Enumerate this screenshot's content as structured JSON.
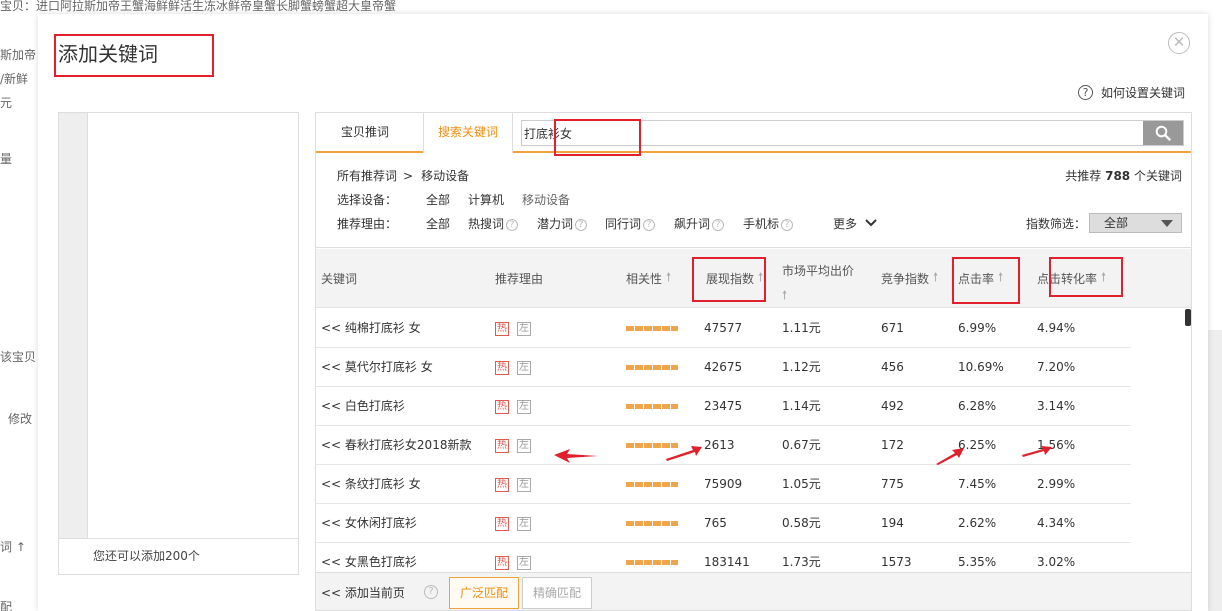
{
  "background": {
    "top_text": "宝贝：进口阿拉斯加帝王蟹海鲜鲜活生冻冰鲜帝皇蟹长脚蟹螃蟹超大皇帝蟹",
    "left_fragments": [
      "斯加帝",
      "/新鲜",
      "元",
      "量",
      "该宝贝",
      "修改",
      "词 ↑",
      "配"
    ]
  },
  "modal": {
    "title": "添加关键词",
    "close_icon": "close-icon",
    "help_text": "如何设置关键词",
    "left_panel_footer": "您还可以添加200个",
    "tabs": [
      "宝贝推词",
      "搜索关键词"
    ],
    "search": {
      "value": "打底衫女",
      "placeholder": ""
    },
    "breadcrumb": {
      "root": "所有推荐词",
      "sep": ">",
      "current": "移动设备"
    },
    "total": {
      "prefix": "共推荐",
      "count": "788",
      "suffix": "个关键词"
    },
    "device": {
      "label": "选择设备：",
      "options": [
        "全部",
        "计算机",
        "移动设备"
      ]
    },
    "reason": {
      "label": "推荐理由：",
      "options": [
        "全部",
        "热搜词",
        "潜力词",
        "同行词",
        "飙升词",
        "手机标"
      ]
    },
    "more": "更多",
    "index_filter": {
      "label": "指数筛选：",
      "value": "全部"
    },
    "columns": [
      "关键词",
      "推荐理由",
      "相关性",
      "展现指数",
      "市场平均出价",
      "竞争指数",
      "点击率",
      "点击转化率"
    ],
    "rows": [
      {
        "keyword": "<< 纯棉打底衫 女",
        "impression": "47577",
        "price": "1.11元",
        "competition": "671",
        "ctr": "6.99%",
        "cvr": "4.94%"
      },
      {
        "keyword": "<< 莫代尔打底衫 女",
        "impression": "42675",
        "price": "1.12元",
        "competition": "456",
        "ctr": "10.69%",
        "cvr": "7.20%"
      },
      {
        "keyword": "<< 白色打底衫",
        "impression": "23475",
        "price": "1.14元",
        "competition": "492",
        "ctr": "6.28%",
        "cvr": "3.14%"
      },
      {
        "keyword": "<< 春秋打底衫女2018新款",
        "impression": "2613",
        "price": "0.67元",
        "competition": "172",
        "ctr": "6.25%",
        "cvr": "1.56%"
      },
      {
        "keyword": "<< 条纹打底衫 女",
        "impression": "75909",
        "price": "1.05元",
        "competition": "775",
        "ctr": "7.45%",
        "cvr": "2.99%"
      },
      {
        "keyword": "<< 女休闲打底衫",
        "impression": "765",
        "price": "0.58元",
        "competition": "194",
        "ctr": "2.62%",
        "cvr": "4.34%"
      },
      {
        "keyword": "<< 女黑色打底衫",
        "impression": "183141",
        "price": "1.73元",
        "competition": "1573",
        "ctr": "5.35%",
        "cvr": "3.02%"
      }
    ],
    "tags": {
      "hot": "热",
      "left": "左"
    },
    "footer": {
      "add_page": "<< 添加当前页",
      "broad_match": "广泛匹配",
      "exact_match": "精确匹配"
    }
  },
  "colors": {
    "accent": "#f08c0f",
    "annotation_red": "#e0202d",
    "hot_tag": "#e05a4f"
  }
}
